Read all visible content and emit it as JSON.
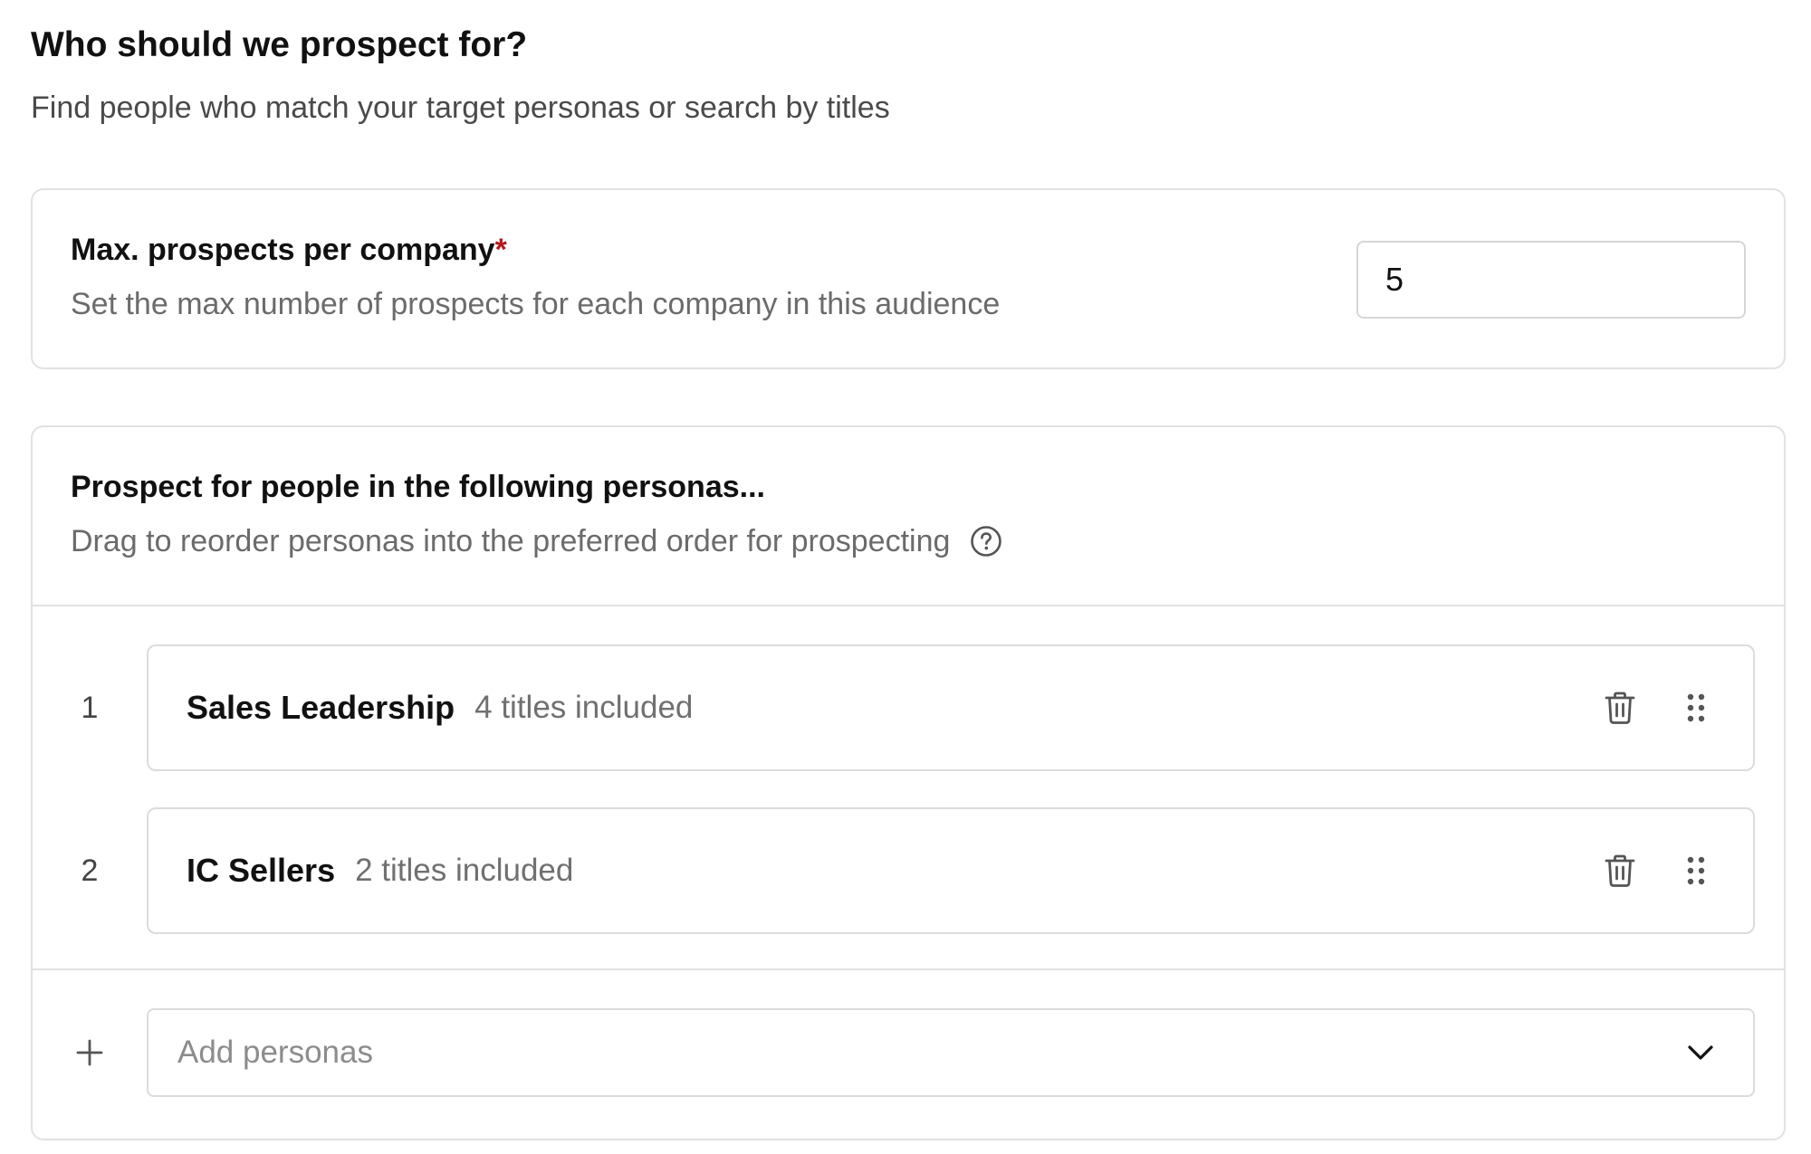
{
  "header": {
    "title": "Who should we prospect for?",
    "subtitle": "Find people who match your target personas or search by titles"
  },
  "max_prospects": {
    "label": "Max. prospects per company",
    "required_marker": "*",
    "help": "Set the max number of prospects for each company in this audience",
    "value": "5"
  },
  "personas": {
    "title": "Prospect for people in the following personas...",
    "help": "Drag to reorder personas into the preferred order for prospecting",
    "help_icon": "question-circle-icon",
    "items": [
      {
        "index": "1",
        "name": "Sales Leadership",
        "count": "4 titles included"
      },
      {
        "index": "2",
        "name": "IC Sellers",
        "count": "2 titles included"
      }
    ],
    "add": {
      "icon": "plus-icon",
      "placeholder": "Add personas",
      "dropdown_icon": "chevron-down-icon"
    }
  },
  "colors": {
    "required": "#b8141b",
    "border": "#e2e2e2",
    "muted_text": "#6b6b6b"
  }
}
